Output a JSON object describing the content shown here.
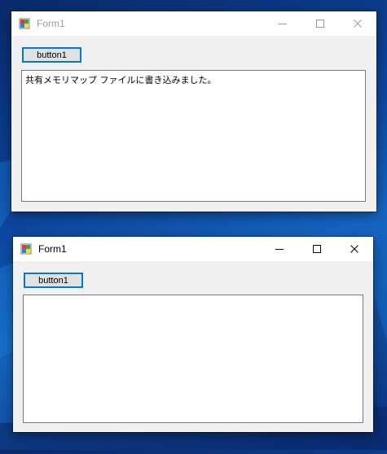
{
  "windows": [
    {
      "title": "Form1",
      "state": "inactive",
      "button_label": "button1",
      "textbox_value": "共有メモリマップ ファイルに書き込みました。"
    },
    {
      "title": "Form1",
      "state": "active",
      "button_label": "button1",
      "textbox_value": ""
    }
  ],
  "icons": {
    "app": "form-app-icon",
    "minimize": "minimize-icon",
    "maximize": "maximize-icon",
    "close": "close-icon"
  },
  "colors": {
    "desktop": "#0d47a1",
    "window_bg": "#f0f0f0",
    "titlebar_bg": "#ffffff",
    "button_border": "#0078d7",
    "button_bg": "#e1e1e1",
    "inactive_title": "#9a9a9a"
  }
}
